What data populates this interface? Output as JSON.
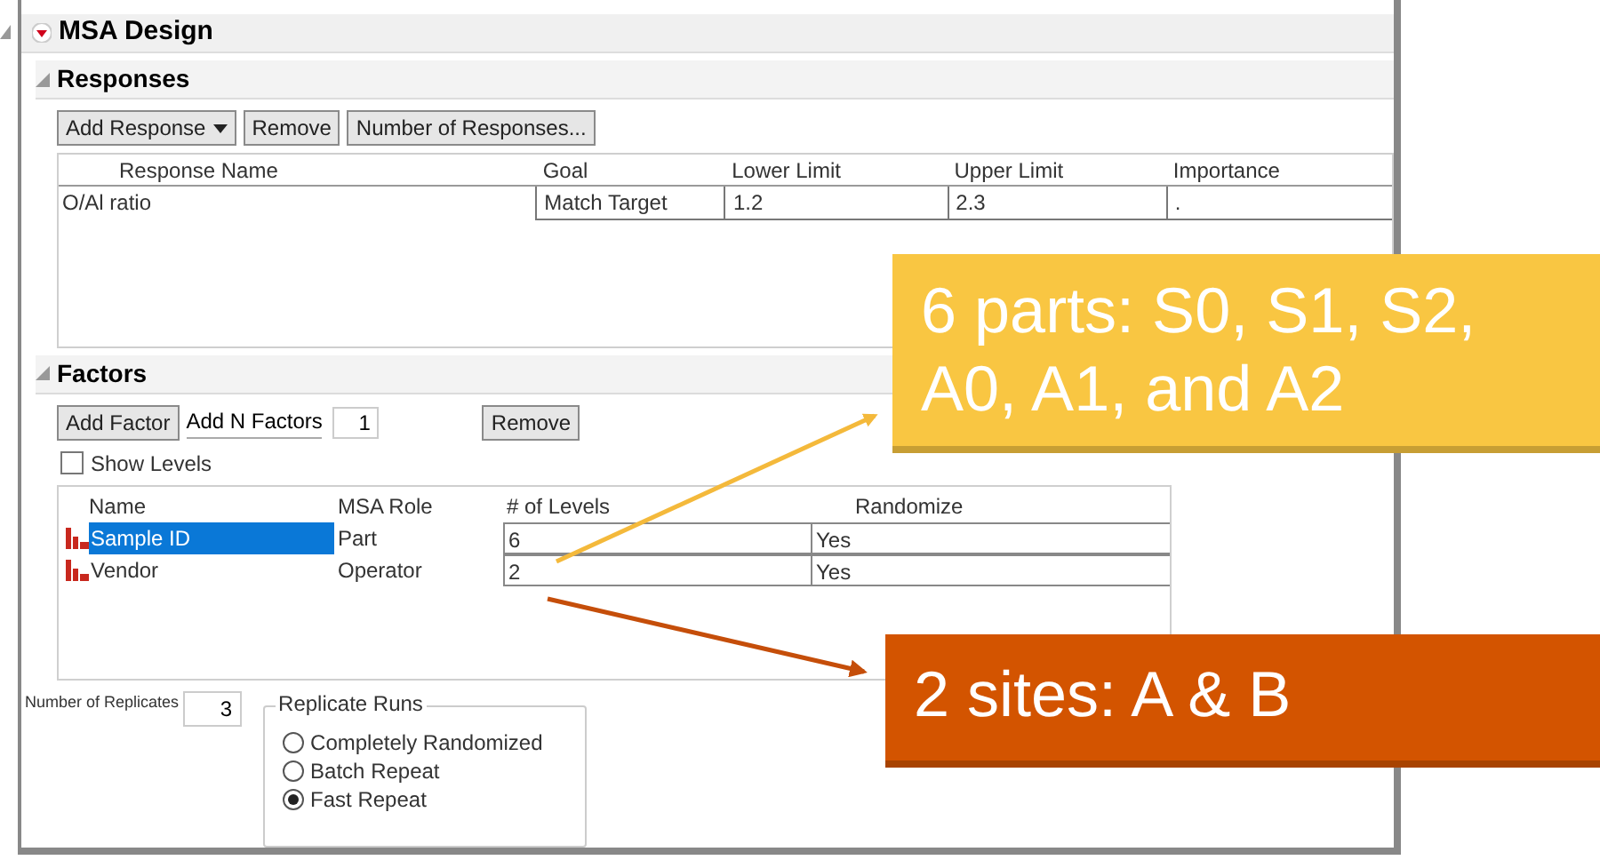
{
  "window": {
    "title": "MSA Design"
  },
  "responses": {
    "title": "Responses",
    "buttons": [
      {
        "label": "Add Response",
        "kind": "dropdown"
      },
      {
        "label": "Remove",
        "kind": "plain"
      },
      {
        "label": "Number of Responses...",
        "kind": "plain"
      }
    ],
    "columns": [
      "Response Name",
      "Goal",
      "Lower Limit",
      "Upper Limit",
      "Importance"
    ],
    "rows": [
      [
        "O/Al ratio",
        "Match Target",
        "1.2",
        "2.3",
        "."
      ]
    ]
  },
  "factors": {
    "title": "Factors",
    "add_factor": "Add Factor",
    "add_n_label": "Add N Factors",
    "add_n_value": "1",
    "remove": "Remove",
    "show_levels": {
      "label": "Show Levels",
      "checked": false
    },
    "columns": [
      "Name",
      "MSA Role",
      "# of Levels",
      "Randomize"
    ],
    "rows": [
      {
        "name": "Sample ID",
        "role": "Part",
        "levels": "6",
        "randomize": "Yes",
        "selected": true
      },
      {
        "name": "Vendor",
        "role": "Operator",
        "levels": "2",
        "randomize": "Yes",
        "selected": false
      }
    ]
  },
  "replicates": {
    "label": "Number of Replicates",
    "value": "3"
  },
  "replicate_runs": {
    "title": "Replicate Runs",
    "options": [
      {
        "label": "Completely Randomized",
        "selected": false
      },
      {
        "label": "Batch Repeat",
        "selected": false
      },
      {
        "label": "Fast Repeat",
        "selected": true
      }
    ]
  },
  "callouts": [
    {
      "text": "6 parts: S0, S1, S2, A0, A1, and A2",
      "color": "#f9c642"
    },
    {
      "text": "2 sites: A & B",
      "color": "#d35400"
    }
  ]
}
